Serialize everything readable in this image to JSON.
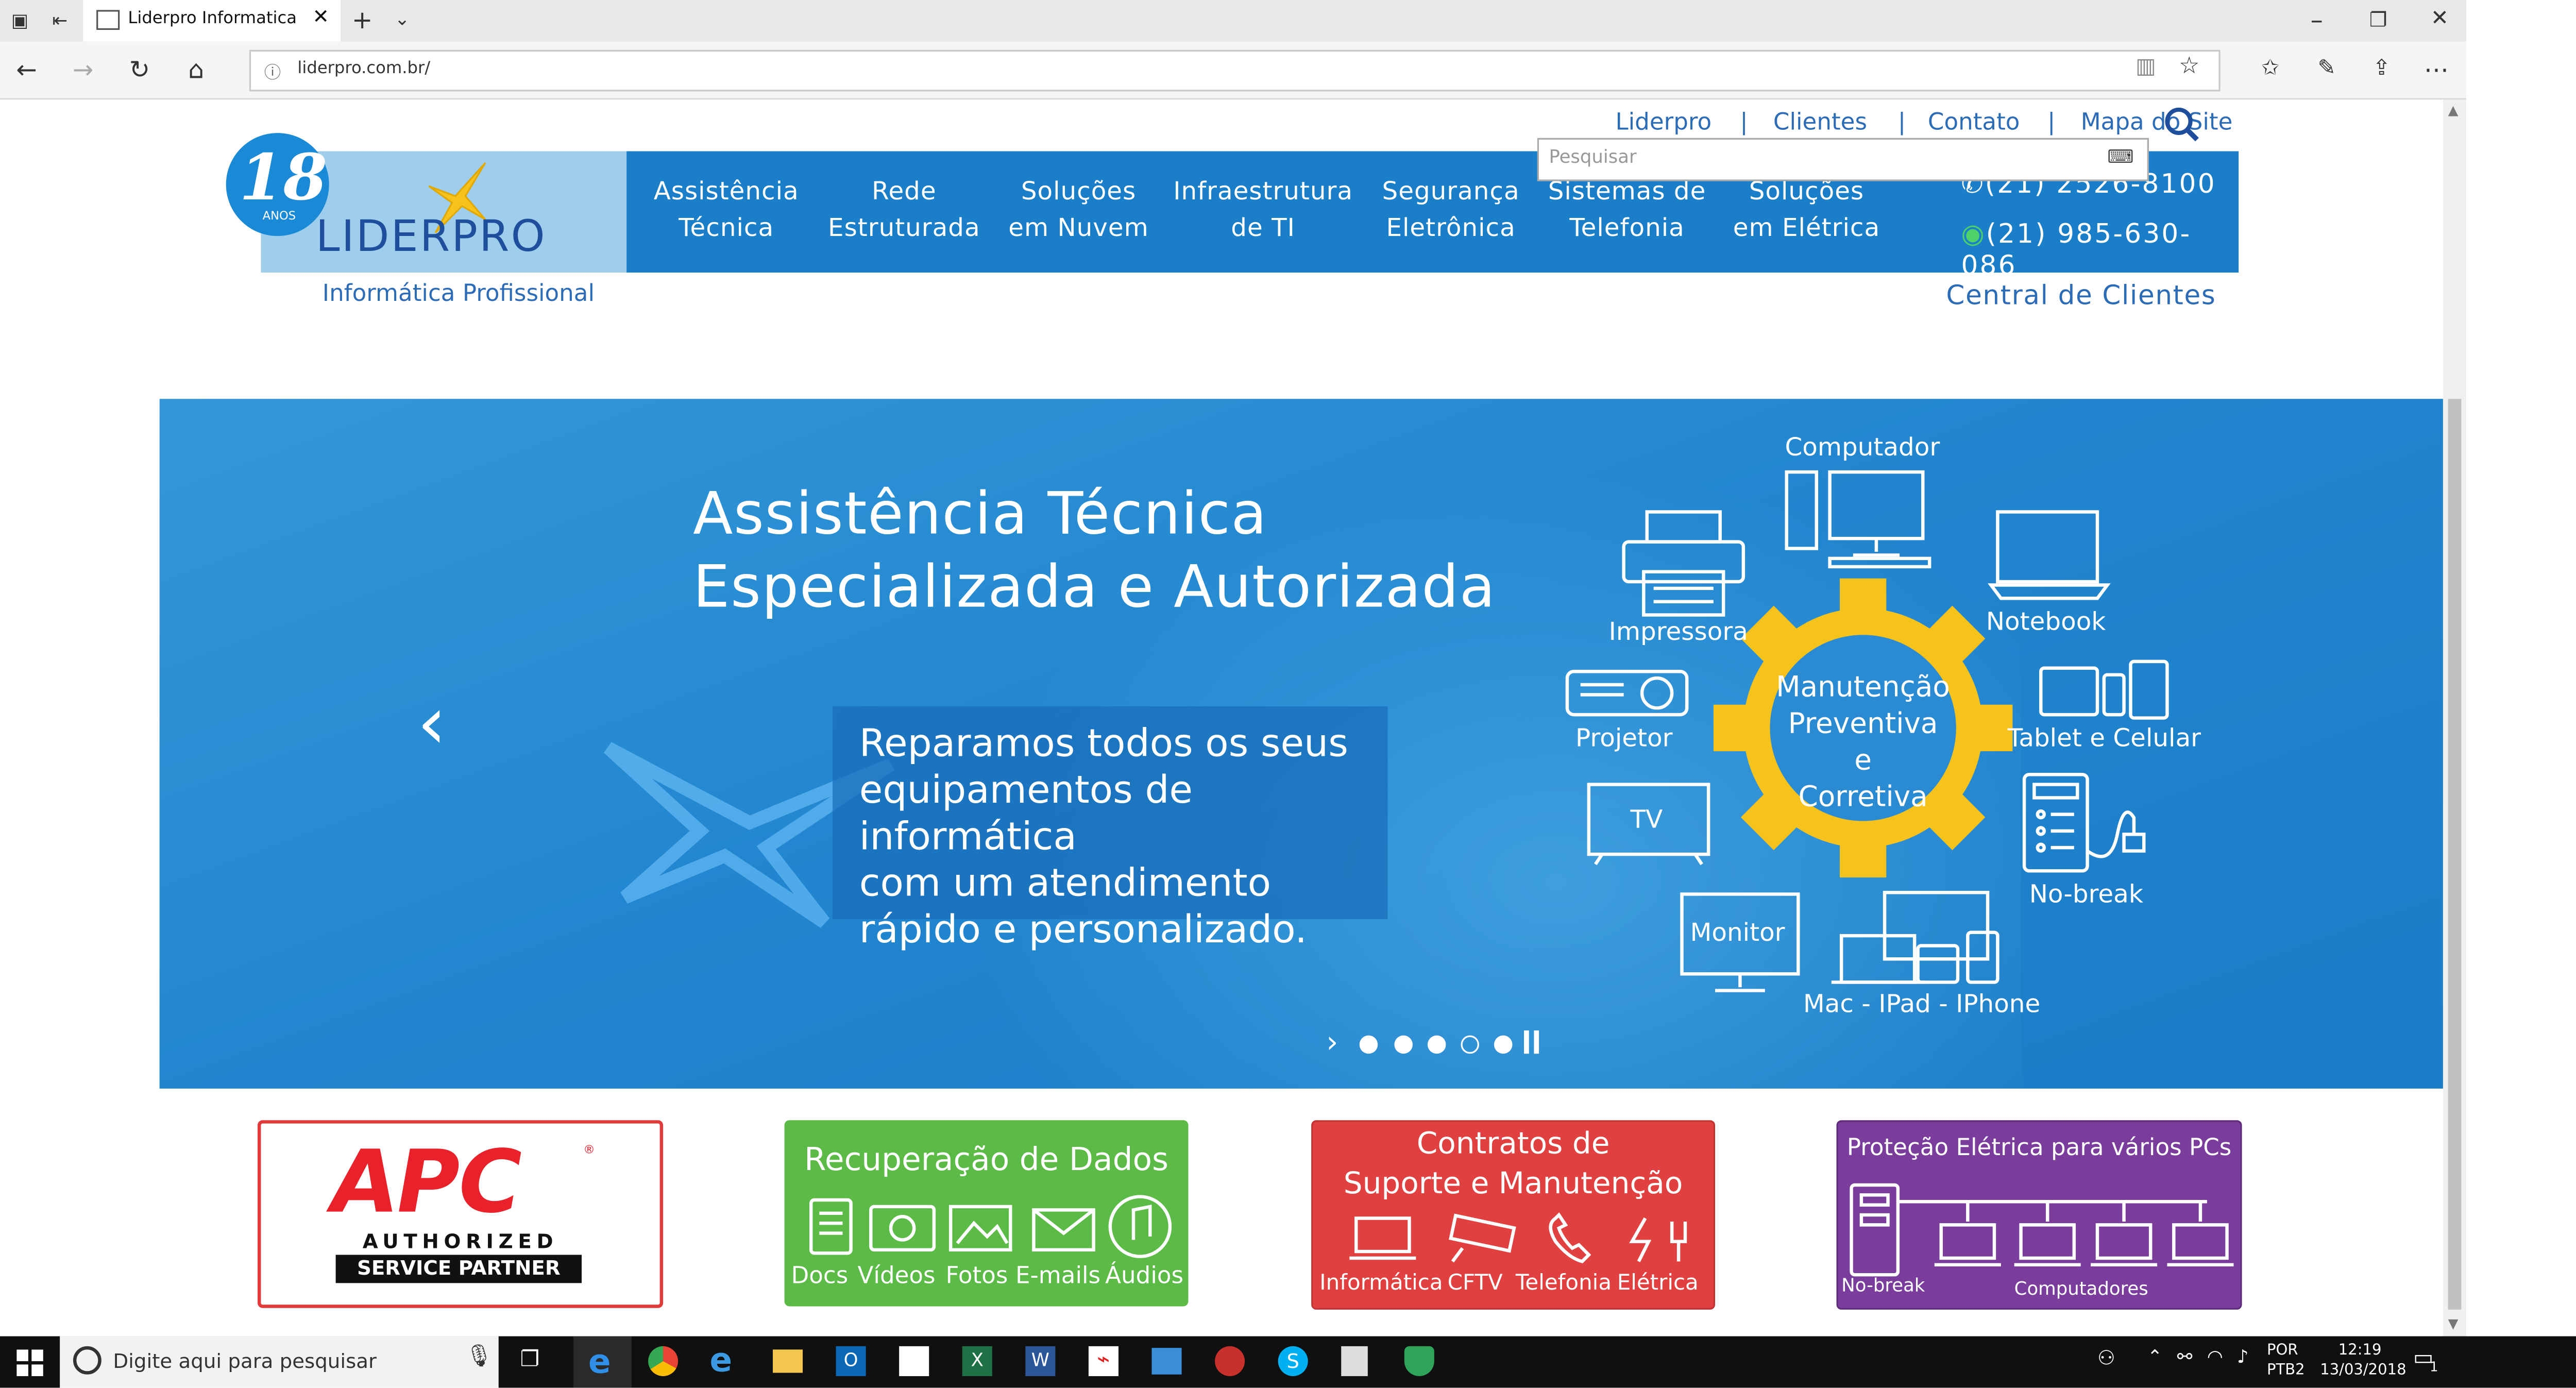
{
  "browser": {
    "tab_title": "Liderpro Informatica",
    "url": "liderpro.com.br/"
  },
  "site": {
    "top_links": [
      "Liderpro",
      "Clientes",
      "Contato",
      "Mapa do Site"
    ],
    "search_placeholder": "Pesquisar",
    "logo": {
      "badge": "18",
      "badge_sub": "ANOS",
      "name": "LIDERPRO",
      "tagline": "Informática Profissional"
    },
    "menu": [
      {
        "line1": "Assistência",
        "line2": "Técnica"
      },
      {
        "line1": "Rede",
        "line2": "Estruturada"
      },
      {
        "line1": "Soluções",
        "line2": "em Nuvem"
      },
      {
        "line1": "Infraestrutura",
        "line2": "de TI"
      },
      {
        "line1": "Segurança",
        "line2": "Eletrônica"
      },
      {
        "line1": "Sistemas de",
        "line2": "Telefonia"
      },
      {
        "line1": "Soluções",
        "line2": "em Elétrica"
      }
    ],
    "phone1": "(21) 2526-8100",
    "phone2": "(21) 985-630-086",
    "central_clientes": "Central de Clientes"
  },
  "hero": {
    "title_line1": "Assistência Técnica",
    "title_line2": "Especializada e Autorizada",
    "body": [
      "Reparamos todos os seus",
      "equipamentos de informática",
      "com um atendimento",
      "rápido e personalizado."
    ],
    "gear_text": [
      "Manutenção",
      "Preventiva",
      "e",
      "Corretiva"
    ],
    "devices": {
      "computador": "Computador",
      "impressora": "Impressora",
      "notebook": "Notebook",
      "projetor": "Projetor",
      "tablet": "Tablet e Celular",
      "tv": "TV",
      "nobreak": "No-break",
      "monitor": "Monitor",
      "mac": "Mac - IPad - IPhone"
    },
    "slides_total": 5,
    "slide_active": 4
  },
  "banners": {
    "apc": {
      "brand": "APC",
      "line1": "AUTHORIZED",
      "line2": "SERVICE PARTNER"
    },
    "recuperacao": {
      "title": "Recuperação de Dados",
      "items": [
        "Docs",
        "Vídeos",
        "Fotos",
        "E-mails",
        "Áudios"
      ]
    },
    "contratos": {
      "title1": "Contratos de",
      "title2": "Suporte e Manutenção",
      "items": [
        "Informática",
        "CFTV",
        "Telefonia",
        "Elétrica"
      ]
    },
    "protecao": {
      "title": "Proteção Elétrica para vários PCs",
      "left": "No-break",
      "right": "Computadores"
    }
  },
  "taskbar": {
    "search_placeholder": "Digite aqui para pesquisar",
    "lang1": "POR",
    "lang2": "PTB2",
    "time": "12:19",
    "date": "13/03/2018",
    "notif_count": "1"
  },
  "colors": {
    "brand_blue": "#1a7ec8",
    "link_blue": "#2c6bb5",
    "gear_yellow": "#f6c21c",
    "green": "#5cba47",
    "red": "#e0403f",
    "purple": "#7a3d9c"
  }
}
